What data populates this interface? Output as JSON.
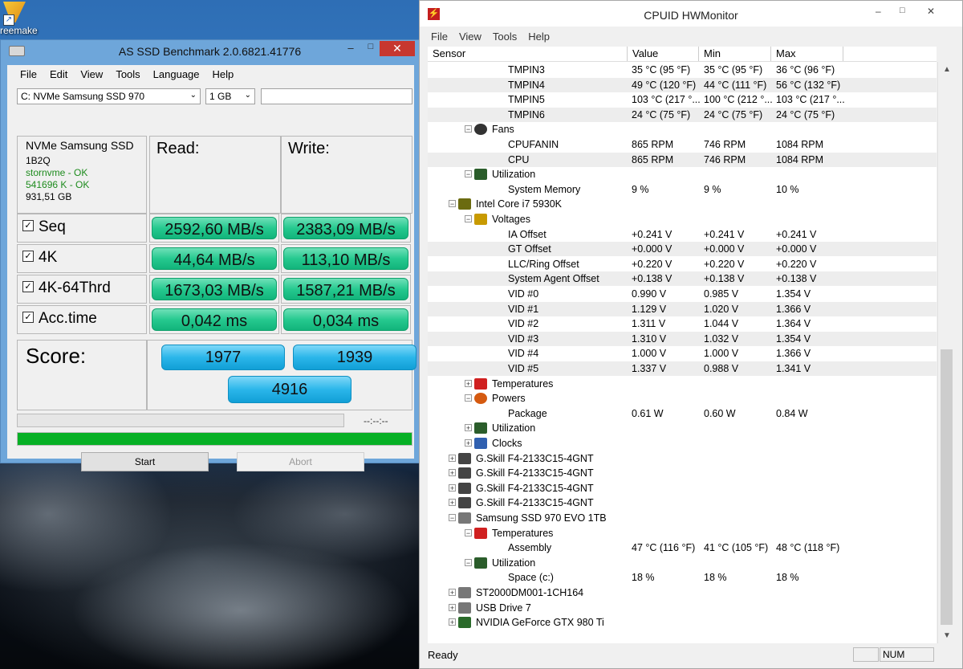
{
  "desktop": {
    "icon_label": "reemake"
  },
  "asssd": {
    "title": "AS SSD Benchmark 2.0.6821.41776",
    "minimize": "–",
    "maximize": "□",
    "close": "✕",
    "menu": [
      "File",
      "Edit",
      "View",
      "Tools",
      "Language",
      "Help"
    ],
    "drive_select": "C: NVMe Samsung SSD 970",
    "size_select": "1 GB",
    "info": {
      "name": "NVMe Samsung SSD",
      "firmware": "1B2Q",
      "driver": "stornvme - OK",
      "alignment": "541696 K - OK",
      "capacity": "931,51 GB"
    },
    "read_header": "Read:",
    "write_header": "Write:",
    "rows": [
      {
        "label": "Seq",
        "checked": true,
        "read": "2592,60 MB/s",
        "write": "2383,09 MB/s"
      },
      {
        "label": "4K",
        "checked": true,
        "read": "44,64 MB/s",
        "write": "113,10 MB/s"
      },
      {
        "label": "4K-64Thrd",
        "checked": true,
        "read": "1673,03 MB/s",
        "write": "1587,21 MB/s"
      },
      {
        "label": "Acc.time",
        "checked": true,
        "read": "0,042 ms",
        "write": "0,034 ms"
      }
    ],
    "score_label": "Score:",
    "score_read": "1977",
    "score_write": "1939",
    "score_total": "4916",
    "timer": "--:--:--",
    "progress_fraction": 1.0,
    "start_label": "Start",
    "abort_label": "Abort"
  },
  "hwmonitor": {
    "title": "CPUID HWMonitor",
    "minimize": "–",
    "maximize": "□",
    "close": "✕",
    "menu": [
      "File",
      "View",
      "Tools",
      "Help"
    ],
    "columns": [
      "Sensor",
      "Value",
      "Min",
      "Max"
    ],
    "rows": [
      {
        "level": 4,
        "label": "TMPIN3",
        "value": "35 °C  (95 °F)",
        "min": "35 °C  (95 °F)",
        "max": "36 °C  (96 °F)"
      },
      {
        "level": 4,
        "label": "TMPIN4",
        "value": "49 °C  (120 °F)",
        "min": "44 °C  (111 °F)",
        "max": "56 °C  (132 °F)"
      },
      {
        "level": 4,
        "label": "TMPIN5",
        "value": "103 °C  (217 °...",
        "min": "100 °C  (212 °...",
        "max": "103 °C  (217 °..."
      },
      {
        "level": 4,
        "label": "TMPIN6",
        "value": "24 °C  (75 °F)",
        "min": "24 °C  (75 °F)",
        "max": "24 °C  (75 °F)"
      },
      {
        "level": 2,
        "label": "Fans",
        "icon": "fan-icon",
        "exp": "−"
      },
      {
        "level": 4,
        "label": "CPUFANIN",
        "value": "865 RPM",
        "min": "746 RPM",
        "max": "1084 RPM"
      },
      {
        "level": 4,
        "label": "CPU",
        "value": "865 RPM",
        "min": "746 RPM",
        "max": "1084 RPM"
      },
      {
        "level": 2,
        "label": "Utilization",
        "icon": "utilization-icon",
        "exp": "−"
      },
      {
        "level": 4,
        "label": "System Memory",
        "value": "9 %",
        "min": "9 %",
        "max": "10 %"
      },
      {
        "level": 1,
        "label": "Intel Core i7 5930K",
        "icon": "cpu-icon",
        "exp": "−"
      },
      {
        "level": 2,
        "label": "Voltages",
        "icon": "voltage-icon",
        "exp": "−"
      },
      {
        "level": 4,
        "label": "IA Offset",
        "value": "+0.241 V",
        "min": "+0.241 V",
        "max": "+0.241 V"
      },
      {
        "level": 4,
        "label": "GT Offset",
        "value": "+0.000 V",
        "min": "+0.000 V",
        "max": "+0.000 V"
      },
      {
        "level": 4,
        "label": "LLC/Ring Offset",
        "value": "+0.220 V",
        "min": "+0.220 V",
        "max": "+0.220 V"
      },
      {
        "level": 4,
        "label": "System Agent Offset",
        "value": "+0.138 V",
        "min": "+0.138 V",
        "max": "+0.138 V"
      },
      {
        "level": 4,
        "label": "VID #0",
        "value": "0.990 V",
        "min": "0.985 V",
        "max": "1.354 V"
      },
      {
        "level": 4,
        "label": "VID #1",
        "value": "1.129 V",
        "min": "1.020 V",
        "max": "1.366 V"
      },
      {
        "level": 4,
        "label": "VID #2",
        "value": "1.311 V",
        "min": "1.044 V",
        "max": "1.364 V"
      },
      {
        "level": 4,
        "label": "VID #3",
        "value": "1.310 V",
        "min": "1.032 V",
        "max": "1.354 V"
      },
      {
        "level": 4,
        "label": "VID #4",
        "value": "1.000 V",
        "min": "1.000 V",
        "max": "1.366 V"
      },
      {
        "level": 4,
        "label": "VID #5",
        "value": "1.337 V",
        "min": "0.988 V",
        "max": "1.341 V"
      },
      {
        "level": 2,
        "label": "Temperatures",
        "icon": "thermometer-icon",
        "exp": "+"
      },
      {
        "level": 2,
        "label": "Powers",
        "icon": "power-icon",
        "exp": "−"
      },
      {
        "level": 4,
        "label": "Package",
        "value": "0.61 W",
        "min": "0.60 W",
        "max": "0.84 W"
      },
      {
        "level": 2,
        "label": "Utilization",
        "icon": "utilization-icon",
        "exp": "+"
      },
      {
        "level": 2,
        "label": "Clocks",
        "icon": "clock-icon",
        "exp": "+"
      },
      {
        "level": 1,
        "label": "G.Skill F4-2133C15-4GNT",
        "icon": "ram-icon",
        "exp": "+"
      },
      {
        "level": 1,
        "label": "G.Skill F4-2133C15-4GNT",
        "icon": "ram-icon",
        "exp": "+"
      },
      {
        "level": 1,
        "label": "G.Skill F4-2133C15-4GNT",
        "icon": "ram-icon",
        "exp": "+"
      },
      {
        "level": 1,
        "label": "G.Skill F4-2133C15-4GNT",
        "icon": "ram-icon",
        "exp": "+"
      },
      {
        "level": 1,
        "label": "Samsung SSD 970 EVO 1TB",
        "icon": "disk-icon",
        "exp": "−"
      },
      {
        "level": 2,
        "label": "Temperatures",
        "icon": "thermometer-icon",
        "exp": "−"
      },
      {
        "level": 4,
        "label": "Assembly",
        "value": "47 °C  (116 °F)",
        "min": "41 °C  (105 °F)",
        "max": "48 °C  (118 °F)"
      },
      {
        "level": 2,
        "label": "Utilization",
        "icon": "utilization-icon",
        "exp": "−"
      },
      {
        "level": 4,
        "label": "Space (c:)",
        "value": "18 %",
        "min": "18 %",
        "max": "18 %"
      },
      {
        "level": 1,
        "label": "ST2000DM001-1CH164",
        "icon": "disk-icon",
        "exp": "+"
      },
      {
        "level": 1,
        "label": "USB Drive 7",
        "icon": "disk-icon",
        "exp": "+"
      },
      {
        "level": 1,
        "label": "NVIDIA GeForce GTX 980 Ti",
        "icon": "gpu-icon",
        "exp": "+"
      }
    ],
    "status": "Ready",
    "num_indicator": "NUM"
  }
}
